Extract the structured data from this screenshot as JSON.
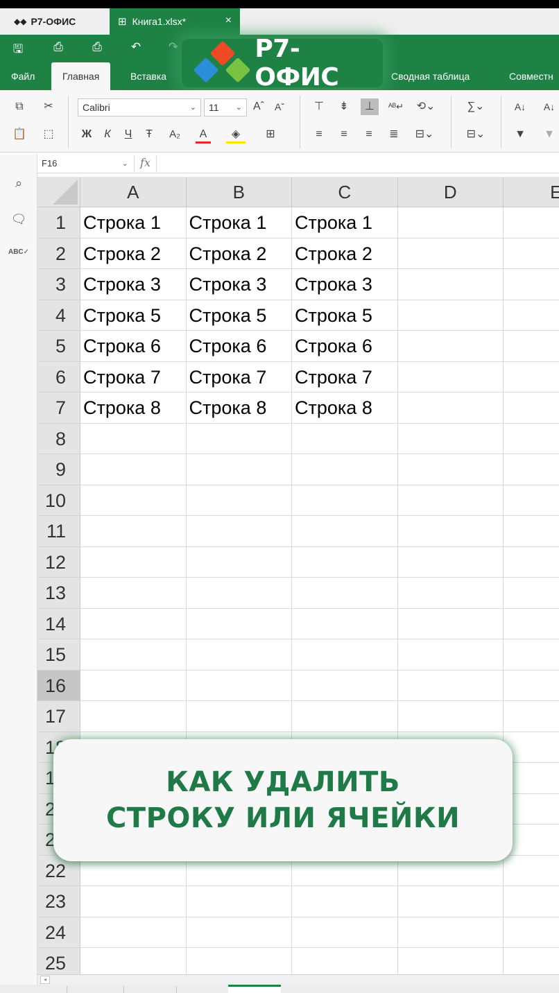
{
  "app_tab": {
    "icon": "r7-logo-icon",
    "label": "Р7-ОФИС"
  },
  "doc_tab": {
    "icon": "spreadsheet-icon",
    "label": "Книга1.xlsx*",
    "close": "×"
  },
  "menu": {
    "file": "Файл",
    "home": "Главная",
    "insert": "Вставка",
    "pivot": "Сводная таблица",
    "collab": "Совместн"
  },
  "logo": {
    "text": "Р7-ОФИС",
    "colors": [
      "#ef4a23",
      "#2a8fd8",
      "#7cc242"
    ]
  },
  "toolbar": {
    "font_name": "Calibri",
    "font_size": "11",
    "grow_font": "Aˆ",
    "shrink_font": "Aˇ",
    "bold": "Ж",
    "italic": "К",
    "underline": "Ч",
    "strike": "Ŧ",
    "subscript": "A₂",
    "font_color_letter": "A",
    "font_color": "#e3262b",
    "highlight_color": "#ffe600",
    "sum": "∑",
    "wrap_text": "ᴬᴮ"
  },
  "formula_bar": {
    "cell_ref": "F16",
    "fx": "fx",
    "value": ""
  },
  "grid": {
    "columns": [
      "A",
      "B",
      "C",
      "D",
      "E"
    ],
    "rows": [
      "1",
      "2",
      "3",
      "4",
      "5",
      "6",
      "7",
      "8",
      "9",
      "10",
      "11",
      "12",
      "13",
      "14",
      "15",
      "16",
      "17",
      "18",
      "19",
      "20",
      "21",
      "22",
      "23",
      "24",
      "25"
    ],
    "selected_row": "16",
    "cells": [
      [
        "Строка 1",
        "Строка 1",
        "Строка 1"
      ],
      [
        "Строка 2",
        "Строка 2",
        "Строка 2"
      ],
      [
        "Строка 3",
        "Строка 3",
        "Строка 3"
      ],
      [
        "Строка 5",
        "Строка 5",
        "Строка 5"
      ],
      [
        "Строка 6",
        "Строка 6",
        "Строка 6"
      ],
      [
        "Строка 7",
        "Строка 7",
        "Строка 7"
      ],
      [
        "Строка 8",
        "Строка 8",
        "Строка 8"
      ]
    ]
  },
  "card": {
    "line1": "КАК УДАЛИТЬ",
    "line2": "СТРОКУ ИЛИ ЯЧЕЙКИ"
  },
  "colors": {
    "brand_green": "#1f8245",
    "card_text": "#1f7a48"
  }
}
